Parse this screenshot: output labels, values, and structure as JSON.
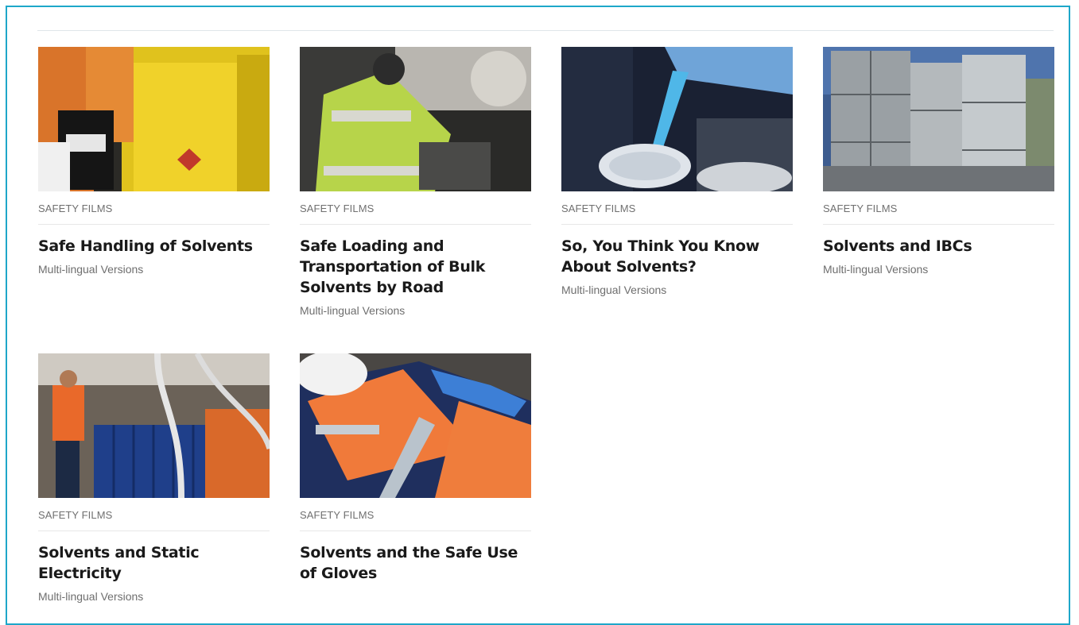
{
  "cards": [
    {
      "category": "SAFETY FILMS",
      "title": "Safe Handling of Solvents",
      "subtitle": "Multi-lingual Versions"
    },
    {
      "category": "SAFETY FILMS",
      "title": "Safe Loading and Transportation of Bulk Solvents by Road",
      "subtitle": "Multi-lingual Versions"
    },
    {
      "category": "SAFETY FILMS",
      "title": "So, You Think You Know About Solvents?",
      "subtitle": "Multi-lingual Versions"
    },
    {
      "category": "SAFETY FILMS",
      "title": "Solvents and IBCs",
      "subtitle": "Multi-lingual Versions"
    },
    {
      "category": "SAFETY FILMS",
      "title": "Solvents and Static Electricity",
      "subtitle": "Multi-lingual Versions"
    },
    {
      "category": "SAFETY FILMS",
      "title": "Solvents and the Safe Use of Gloves",
      "subtitle": ""
    }
  ],
  "colors": {
    "frame": "#1ea7c9",
    "title": "#1a1a1a",
    "muted": "#6e6e6e"
  }
}
